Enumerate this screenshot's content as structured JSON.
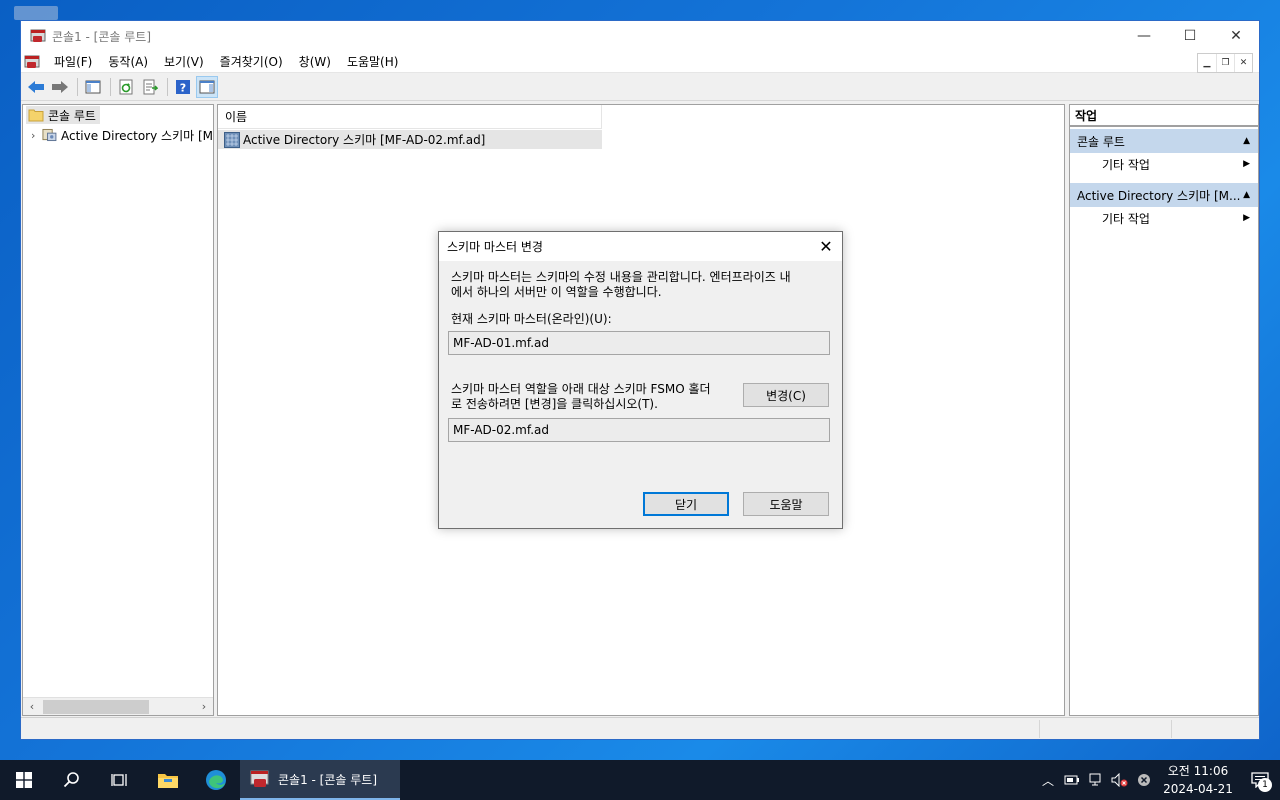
{
  "window": {
    "title": "콘솔1 - [콘솔 루트]",
    "controls": {
      "minimize": "—",
      "maximize": "☐",
      "close": "✕"
    }
  },
  "menu": {
    "items": [
      "파일(F)",
      "동작(A)",
      "보기(V)",
      "즐겨찾기(O)",
      "창(W)",
      "도움말(H)"
    ]
  },
  "tree": {
    "root": "콘솔 루트",
    "child": "Active Directory 스키마 [M"
  },
  "list": {
    "column_name": "이름",
    "rows": [
      "Active Directory 스키마 [MF-AD-02.mf.ad]"
    ]
  },
  "actions": {
    "header": "작업",
    "sections": [
      {
        "title": "콘솔 루트",
        "item": "기타 작업"
      },
      {
        "title": "Active Directory 스키마 [M...",
        "item": "기타 작업"
      }
    ]
  },
  "dialog": {
    "title": "스키마 마스터 변경",
    "description": "스키마 마스터는 스키마의 수정 내용을 관리합니다. 엔터프라이즈 내에서 하나의 서버만 이 역할을 수행합니다.",
    "desc_line1": "스키마 마스터는 스키마의 수정 내용을 관리합니다. 엔터프라이즈 내",
    "desc_line2": "에서 하나의 서버만 이 역할을 수행합니다.",
    "current_label": "현재 스키마 마스터(온라인)(U):",
    "current_value": "MF-AD-01.mf.ad",
    "transfer_line1": "스키마 마스터 역할을 아래 대상 스키마 FSMO 홀더",
    "transfer_line2": "로 전송하려면 [변경]을 클릭하십시오(T).",
    "target_value": "MF-AD-02.mf.ad",
    "change_button": "변경(C)",
    "close_button": "닫기",
    "help_button": "도움말"
  },
  "taskbar": {
    "active_app": "콘솔1 - [콘솔 루트]",
    "clock_time": "오전 11:06",
    "clock_date": "2024-04-21",
    "notification_count": "1"
  },
  "colors": {
    "accent": "#0078d7",
    "action_section": "#c4d7ec",
    "taskbar": "#101a2a"
  }
}
